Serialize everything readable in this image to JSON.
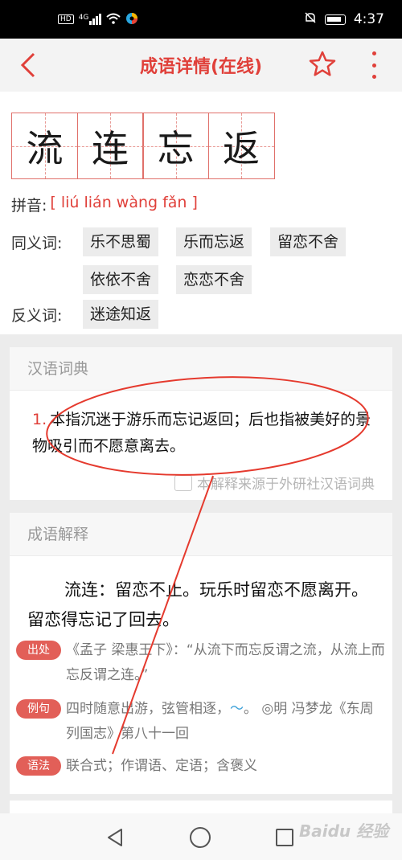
{
  "status_bar": {
    "left_icons": [
      "hd-icon",
      "4g-signal-icon",
      "wifi-icon",
      "app-icon"
    ],
    "signal_label": "HD",
    "net_label": "4G",
    "time": "4:37"
  },
  "app_bar": {
    "title": "成语详情(在线)"
  },
  "idiom": {
    "chars": [
      "流",
      "连",
      "忘",
      "返"
    ],
    "pinyin_label": "拼音:",
    "pinyin": "[ liú lián wàng fǎn ]",
    "synonyms_label": "同义词:",
    "synonyms": [
      "乐不思蜀",
      "乐而忘返",
      "留恋不舍",
      "依依不舍",
      "恋恋不舍"
    ],
    "antonyms_label": "反义词:",
    "antonyms": [
      "迷途知返"
    ]
  },
  "dictionary": {
    "title": "汉语词典",
    "number": "1.",
    "definition": "本指沉迷于游乐而忘记返回；后也指被美好的景物吸引而不愿意离去。",
    "source": "本解释来源于外研社汉语词典"
  },
  "explanation": {
    "title": "成语解释",
    "text": "流连：留恋不止。玩乐时留恋不愿离开。留恋得忘记了回去。",
    "origin_badge": "出处",
    "origin_text": "《孟子 梁惠王下》：“从流下而忘反谓之流，从流上而忘反谓之连。”",
    "example_badge": "例句",
    "example_text_a": "四时随意出游，弦管相逐，",
    "example_tilde": "～",
    "example_text_b": "。 ◎明 冯梦龙《东周列国志》第八十一回",
    "grammar_badge": "语法",
    "grammar_text": "联合式；作谓语、定语；含褒义"
  },
  "watermark": "Baidu 经验",
  "colors": {
    "accent": "#e0403a",
    "annotation": "#e53a2e",
    "tag_bg": "#ececec"
  }
}
